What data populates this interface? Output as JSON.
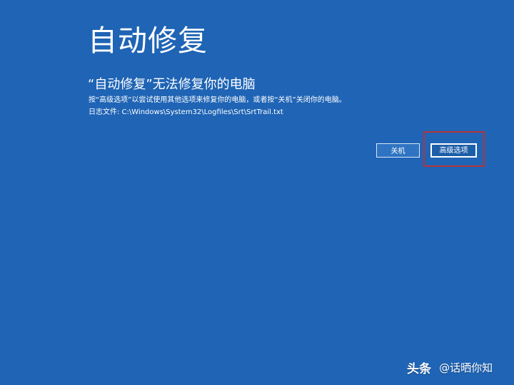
{
  "screen": {
    "title": "自动修复",
    "subtitle": "“自动修复”无法修复你的电脑",
    "description": "按“高级选项”以尝试使用其他选项来修复你的电脑，或者按“关机”关闭你的电脑。",
    "log_file": "日志文件: C:\\Windows\\System32\\Logfiles\\Srt\\SrtTrail.txt"
  },
  "buttons": {
    "shutdown_label": "关机",
    "advanced_label": "高级选项"
  },
  "watermark": {
    "brand": "头条",
    "handle": "@话晒你知"
  },
  "colors": {
    "background": "#1f64b5",
    "text": "#ffffff",
    "highlight": "#b5333b"
  }
}
